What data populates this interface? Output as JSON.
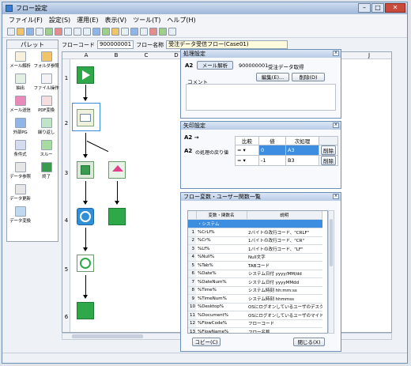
{
  "window": {
    "title": "フロー設定",
    "min": "–",
    "max": "□",
    "close": "✕"
  },
  "menu": [
    "ファイル(F)",
    "設定(S)",
    "運用(E)",
    "表示(V)",
    "ツール(T)",
    "ヘルプ(H)"
  ],
  "palette": {
    "title": "パレット",
    "items": [
      "メール解析",
      "フォルダ参照",
      "抽出",
      "ファイル操作",
      "メール送信",
      "PDF変換",
      "外部PG",
      "繰り返し",
      "条件式",
      "スルー",
      "データ参照",
      "終了",
      "データ更新",
      "",
      "データ変換",
      ""
    ]
  },
  "flowbar": {
    "code_label": "フローコード",
    "code_value": "900000001",
    "name_label": "フロー名称",
    "name_value": "受注データ受信フロー(Case01)"
  },
  "grid": {
    "columns": [
      "A",
      "B",
      "C",
      "D",
      "J"
    ],
    "rows": [
      "1",
      "2",
      "3",
      "4",
      "5",
      "6"
    ]
  },
  "process_panel": {
    "title": "処理設定",
    "row_label": "A2",
    "type_button": "メール解析",
    "code": "900000001",
    "name": "受注データ取得",
    "comment_label": "コメント",
    "edit_button": "編集(E)...",
    "delete_button": "削除(D)"
  },
  "arrow_panel": {
    "title": "矢印設定",
    "header_text": "A2 →",
    "row_label": "A2",
    "return_label": "の処理の戻り値",
    "columns": [
      "比較",
      "値",
      "次処理"
    ],
    "rows": [
      {
        "op": "=",
        "val": "0",
        "next": "A3",
        "action": "削除"
      },
      {
        "op": "=",
        "val": "-1",
        "next": "B3",
        "action": "削除"
      }
    ]
  },
  "var_panel": {
    "title": "フロー変数・ユーザー関数一覧",
    "col_name": "変数・関数名",
    "col_desc": "説明",
    "selected": "・システム",
    "rows": [
      {
        "no": "1",
        "name": "%CrLf%",
        "desc": "2バイトの改行コード、\"CRLF\""
      },
      {
        "no": "2",
        "name": "%Cr%",
        "desc": "1バイトの改行コード、\"CR\""
      },
      {
        "no": "3",
        "name": "%Lf%",
        "desc": "1バイトの改行コード、\"LF\""
      },
      {
        "no": "4",
        "name": "%Null%",
        "desc": "Null文字"
      },
      {
        "no": "5",
        "name": "%Tab%",
        "desc": "TABコード"
      },
      {
        "no": "6",
        "name": "%Date%",
        "desc": "システム日付 yyyy/MM/dd"
      },
      {
        "no": "7",
        "name": "%DateNum%",
        "desc": "システム日付 yyyyMMdd"
      },
      {
        "no": "8",
        "name": "%Time%",
        "desc": "システム時刻 hh:mm:ss"
      },
      {
        "no": "9",
        "name": "%TimeNum%",
        "desc": "システム時刻 hhmmss"
      },
      {
        "no": "10",
        "name": "%Desktop%",
        "desc": "OSにログオンしているユーザのデスクトップ..."
      },
      {
        "no": "11",
        "name": "%Document%",
        "desc": "OSにログオンしているユーザのマイドキュ..."
      },
      {
        "no": "12",
        "name": "%FlowCode%",
        "desc": "フローコード"
      },
      {
        "no": "13",
        "name": "%FlowName%",
        "desc": "フロー名称"
      }
    ],
    "copy_button": "コピー(C)",
    "close_button": "閉じる(X)"
  },
  "colors": {
    "flow_green": "#2fa84a",
    "flow_blue": "#2f8fd8",
    "accent_pink": "#e0418a",
    "selection": "#3d8de0"
  }
}
